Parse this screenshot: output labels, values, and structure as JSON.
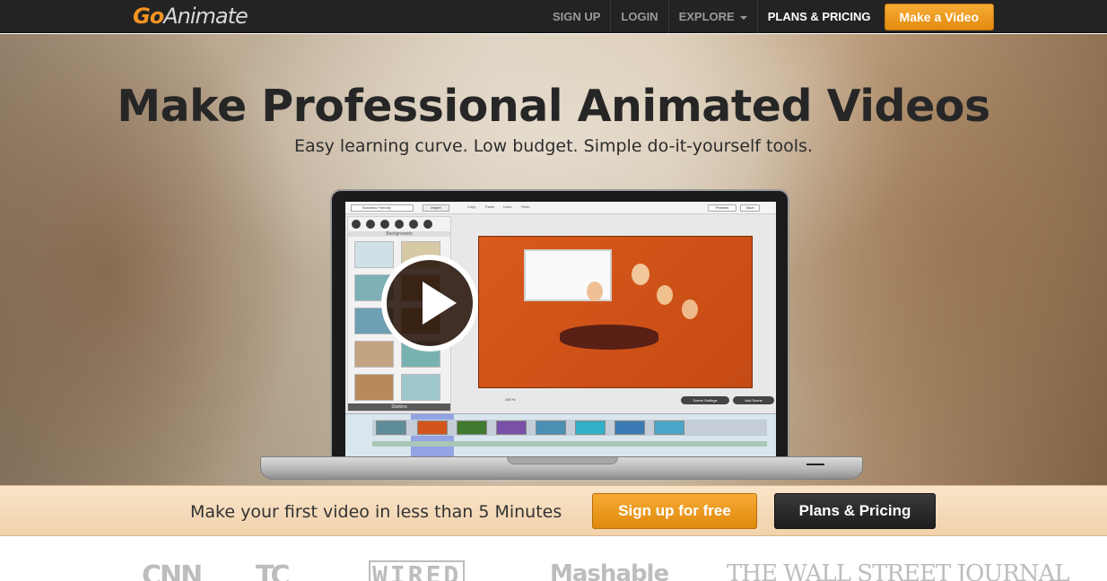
{
  "nav": {
    "logo_go": "Go",
    "logo_rest": "Animate",
    "items": [
      {
        "label": "SIGN UP"
      },
      {
        "label": "LOGIN"
      },
      {
        "label": "EXPLORE"
      },
      {
        "label": "PLANS & PRICING"
      }
    ],
    "cta_label": "Make a Video"
  },
  "hero": {
    "headline": "Make Professional Animated Videos",
    "subline": "Easy learning curve. Low budget. Simple do-it-yourself tools."
  },
  "editor": {
    "theme_select": "Business Friendly",
    "import_label": "Import",
    "tools": [
      "Copy",
      "Paste",
      "Undo",
      "Redo"
    ],
    "preview_label": "Preview",
    "save_label": "Save",
    "panel_label": "Backgrounds",
    "starters_label": "Starters",
    "zoom": "145 %",
    "scene_settings_label": "Scene Settings",
    "add_scene_label": "Add Scene"
  },
  "band": {
    "text": "Make your first video in less than 5 Minutes",
    "signup_label": "Sign up for free",
    "plans_label": "Plans & Pricing"
  },
  "press": {
    "logos": [
      "CNN",
      "TC",
      "WIRED",
      "Mashable",
      "THE WALL STREET JOURNAL"
    ]
  },
  "colors": {
    "accent": "#f29424",
    "nav_bg": "#232323",
    "band_bg": "#f5dab8",
    "dark_button": "#2a2a2a"
  }
}
